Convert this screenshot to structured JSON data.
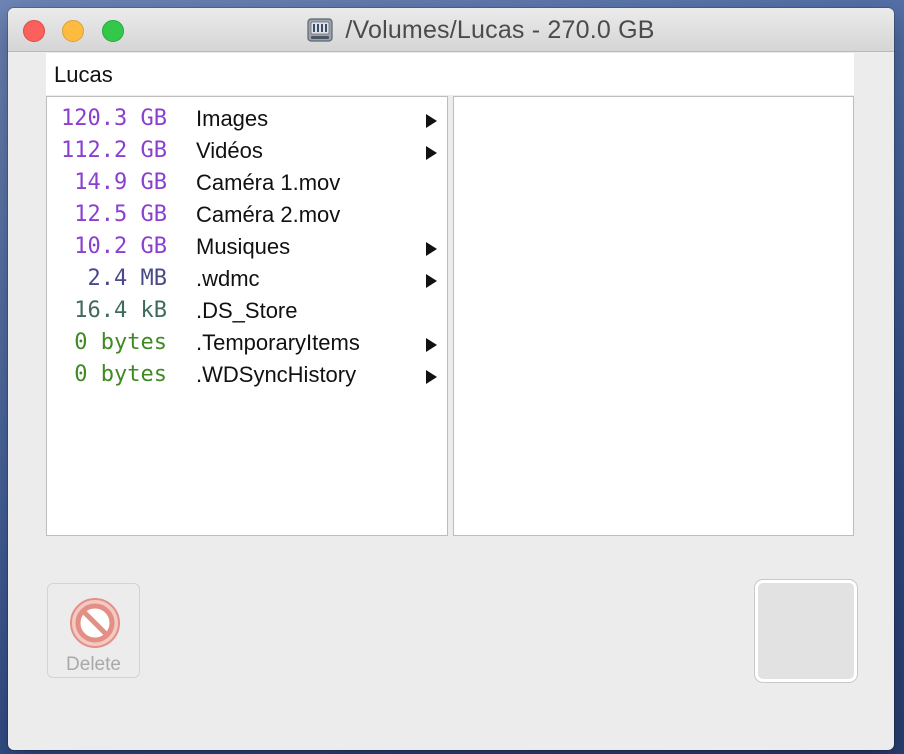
{
  "window": {
    "title": "/Volumes/Lucas - 270.0 GB",
    "title_icon": "external-drive-icon"
  },
  "path": {
    "current": "Lucas"
  },
  "colors": {
    "gb": "#8a3fd1",
    "mb": "#4a4a8a",
    "kb": "#3f6b5f",
    "bytes": "#3f8a24"
  },
  "items": [
    {
      "size": "120.3 GB",
      "name": "Images",
      "folder": true,
      "color": "#8a3fd1"
    },
    {
      "size": "112.2 GB",
      "name": "Vidéos",
      "folder": true,
      "color": "#8a3fd1"
    },
    {
      "size": "14.9 GB",
      "name": "Caméra 1.mov",
      "folder": false,
      "color": "#8a3fd1"
    },
    {
      "size": "12.5 GB",
      "name": "Caméra 2.mov",
      "folder": false,
      "color": "#8a3fd1"
    },
    {
      "size": "10.2 GB",
      "name": "Musiques",
      "folder": true,
      "color": "#8a3fd1"
    },
    {
      "size": "2.4 MB",
      "name": ".wdmc",
      "folder": true,
      "color": "#4a4a8a"
    },
    {
      "size": "16.4 kB",
      "name": ".DS_Store",
      "folder": false,
      "color": "#3f6b5f"
    },
    {
      "size": "0 bytes",
      "name": ".TemporaryItems",
      "folder": true,
      "color": "#3f8a24"
    },
    {
      "size": "0 bytes",
      "name": ".WDSyncHistory",
      "folder": true,
      "color": "#3f8a24"
    }
  ],
  "toolbar": {
    "delete_label": "Delete",
    "delete_icon": "no-entry-icon"
  }
}
